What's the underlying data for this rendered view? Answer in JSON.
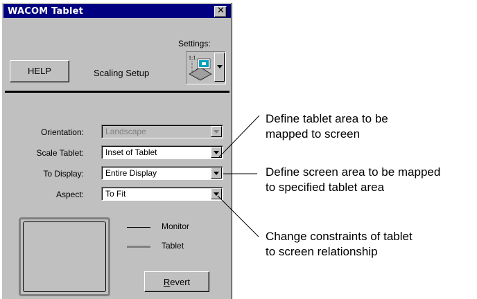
{
  "window": {
    "title": "WACOM Tablet",
    "close_glyph": "✕"
  },
  "header": {
    "settings_label": "Settings:",
    "help_label": "HELP",
    "panel_label": "Scaling Setup",
    "settings_icon": "tablet-settings-icon"
  },
  "fields": {
    "orientation": {
      "label": "Orientation:",
      "value": "Landscape",
      "enabled": false
    },
    "scale_tablet": {
      "label": "Scale Tablet:",
      "value": "Inset of Tablet",
      "enabled": true
    },
    "to_display": {
      "label": "To Display:",
      "value": "Entire Display",
      "enabled": true
    },
    "aspect": {
      "label": "Aspect:",
      "value": "To Fit",
      "enabled": true
    }
  },
  "legend": {
    "monitor": "Monitor",
    "tablet": "Tablet"
  },
  "revert": {
    "mnemonic": "R",
    "rest": "evert"
  },
  "annotations": {
    "scale_line1": "Define tablet area to be",
    "scale_line2": "mapped to screen",
    "display_line1": "Define screen area to be mapped",
    "display_line2": "to specified tablet area",
    "aspect_line1": "Change constraints of tablet",
    "aspect_line2": "to screen relationship"
  }
}
